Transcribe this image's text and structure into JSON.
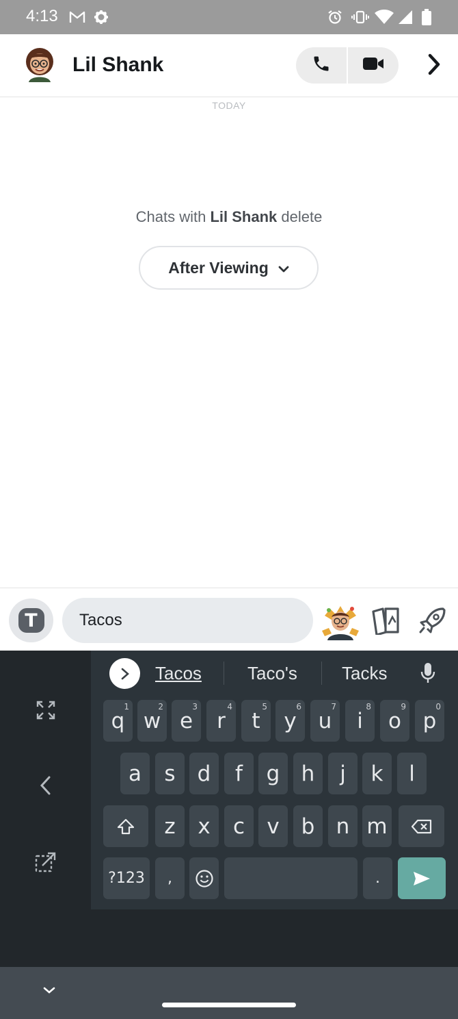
{
  "status_bar": {
    "time": "4:13",
    "icons": [
      "gmail-icon",
      "settings-gear-icon",
      "alarm-icon",
      "vibrate-icon",
      "wifi-icon",
      "signal-icon",
      "battery-icon"
    ]
  },
  "header": {
    "contact_name": "Lil Shank",
    "avatar": "bitmoji-avatar",
    "call_icon": "phone-icon",
    "video_icon": "video-camera-icon",
    "chevron_icon": "chevron-right-icon"
  },
  "chat": {
    "date_label": "TODAY",
    "delete_prefix": "Chats with ",
    "delete_name": "Lil Shank",
    "delete_suffix": " delete",
    "delete_setting": "After Viewing"
  },
  "composer": {
    "text_tool_label": "T",
    "message_value": "Tacos",
    "bitmoji_icon": "bitmoji-sticker-icon",
    "cards_icon": "cards-icon",
    "rocket_icon": "rocket-icon"
  },
  "keyboard": {
    "suggestions": [
      "Tacos",
      "Taco's",
      "Tacks"
    ],
    "row1": [
      {
        "key": "q",
        "hint": "1"
      },
      {
        "key": "w",
        "hint": "2"
      },
      {
        "key": "e",
        "hint": "3"
      },
      {
        "key": "r",
        "hint": "4"
      },
      {
        "key": "t",
        "hint": "5"
      },
      {
        "key": "y",
        "hint": "6"
      },
      {
        "key": "u",
        "hint": "7"
      },
      {
        "key": "i",
        "hint": "8"
      },
      {
        "key": "o",
        "hint": "9"
      },
      {
        "key": "p",
        "hint": "0"
      }
    ],
    "row2": [
      "a",
      "s",
      "d",
      "f",
      "g",
      "h",
      "j",
      "k",
      "l"
    ],
    "row3": [
      "z",
      "x",
      "c",
      "v",
      "b",
      "n",
      "m"
    ],
    "symbols_label": "?123",
    "comma_label": ",",
    "period_label": ".",
    "colors": {
      "background": "#2c343a",
      "key": "#3e474e",
      "send": "#66aaa2"
    }
  },
  "colors": {
    "status_bar": "#9b9b9b",
    "header_text": "#16191c",
    "nav_bar": "#444b52"
  }
}
